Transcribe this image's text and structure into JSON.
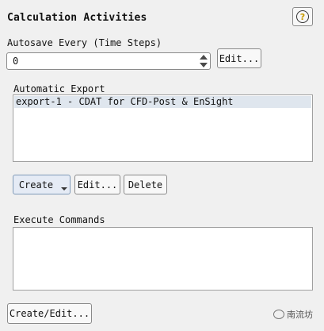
{
  "panel": {
    "title": "Calculation Activities",
    "help_glyph": "?"
  },
  "autosave": {
    "label": "Autosave Every (Time Steps)",
    "value": "0",
    "edit_label": "Edit..."
  },
  "automatic_export": {
    "label": "Automatic Export",
    "items": [
      "export-1 - CDAT for CFD-Post & EnSight"
    ],
    "selected_index": 0,
    "create_label": "Create",
    "edit_label": "Edit...",
    "delete_label": "Delete"
  },
  "execute_commands": {
    "label": "Execute Commands",
    "create_edit_label": "Create/Edit..."
  },
  "watermark": {
    "text": "南流坊"
  },
  "colors": {
    "background": "#f0f0f0",
    "selected_row": "#dfe6ee",
    "create_button": "#e5ebf5",
    "help_icon": "#c89a00"
  },
  "icons": [
    "help-icon",
    "spin-up-icon",
    "spin-down-icon",
    "dropdown-arrow-icon",
    "wechat-logo-icon"
  ]
}
